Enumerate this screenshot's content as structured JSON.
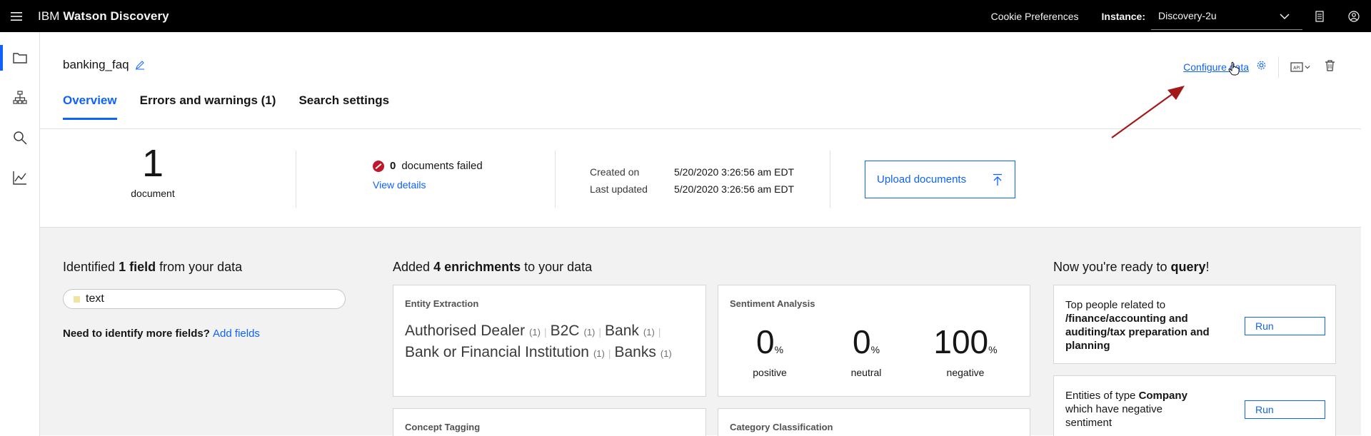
{
  "topbar": {
    "brand_prefix": "IBM",
    "brand_product": "Watson Discovery",
    "cookie_link": "Cookie Preferences",
    "instance_label": "Instance:",
    "instance_value": "Discovery-2u"
  },
  "collection": {
    "name": "banking_faq",
    "configure_link": "Configure data"
  },
  "tabs": [
    {
      "label": "Overview"
    },
    {
      "label": "Errors and warnings (1)"
    },
    {
      "label": "Search settings"
    }
  ],
  "stats": {
    "document_count": "1",
    "document_label": "document",
    "failed_count": "0",
    "failed_label": "documents failed",
    "view_details": "View details",
    "created_label": "Created on",
    "created_value": "5/20/2020 3:26:56 am EDT",
    "updated_label": "Last updated",
    "updated_value": "5/20/2020 3:26:56 am EDT",
    "upload_button": "Upload documents"
  },
  "fields": {
    "title_pre": "Identified ",
    "title_bold": "1 field",
    "title_post": " from your data",
    "field_name": "text",
    "need_more": "Need to identify more fields?",
    "add_fields": "Add fields"
  },
  "enrichments": {
    "title_pre": "Added ",
    "title_bold": "4 enrichments",
    "title_post": " to your data",
    "entity_card_title": "Entity Extraction",
    "entities": [
      {
        "name": "Authorised Dealer",
        "count": "(1)"
      },
      {
        "name": "B2C",
        "count": "(1)"
      },
      {
        "name": "Bank",
        "count": "(1)"
      },
      {
        "name": "Bank or Financial Institution",
        "count": "(1)"
      },
      {
        "name": "Banks",
        "count": "(1)"
      }
    ],
    "sentiment_card_title": "Sentiment Analysis",
    "sentiment": [
      {
        "value": "0",
        "unit": "%",
        "label": "positive"
      },
      {
        "value": "0",
        "unit": "%",
        "label": "neutral"
      },
      {
        "value": "100",
        "unit": "%",
        "label": "negative"
      }
    ],
    "concept_card_title": "Concept Tagging",
    "category_card_title": "Category Classification"
  },
  "query": {
    "title_pre": "Now you're ready to ",
    "title_bold": "query",
    "title_post": "!",
    "q1_pre": "Top people related to ",
    "q1_bold": "/finance/accounting and auditing/tax preparation and planning",
    "q2_pre": "Entities of type ",
    "q2_bold": "Company",
    "q2_post": " which have negative sentiment",
    "run_label": "Run"
  }
}
